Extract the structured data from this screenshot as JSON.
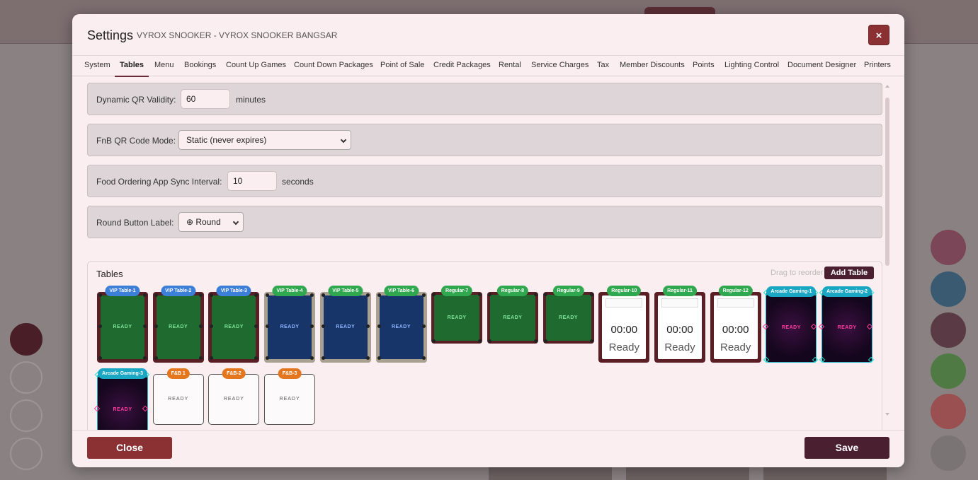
{
  "header": {
    "title": "Settings",
    "subtitle": "VYROX SNOOKER - VYROX SNOOKER BANGSAR",
    "close_icon": "×"
  },
  "tabs": [
    {
      "label": "System"
    },
    {
      "label": "Tables"
    },
    {
      "label": "Menu"
    },
    {
      "label": "Bookings"
    },
    {
      "label": "Count Up Games"
    },
    {
      "label": "Count Down Packages"
    },
    {
      "label": "Point of Sale"
    },
    {
      "label": "Credit Packages"
    },
    {
      "label": "Rental"
    },
    {
      "label": "Service Charges"
    },
    {
      "label": "Tax"
    },
    {
      "label": "Member Discounts"
    },
    {
      "label": "Points"
    },
    {
      "label": "Lighting Control"
    },
    {
      "label": "Document Designer"
    },
    {
      "label": "Printers"
    }
  ],
  "active_tab": "Tables",
  "settings": {
    "qr_validity": {
      "label": "Dynamic QR Validity:",
      "value": "60",
      "unit": "minutes"
    },
    "fnb_qr_mode": {
      "label": "FnB QR Code Mode:",
      "value": "Static (never expires)"
    },
    "sync_interval": {
      "label": "Food Ordering App Sync Interval:",
      "value": "10",
      "unit": "seconds"
    },
    "round_label": {
      "label": "Round Button Label:",
      "value": "⊕ Round"
    }
  },
  "tables_section": {
    "title": "Tables",
    "drag_hint": "Drag to reorder",
    "add_button": "Add Table",
    "tables": [
      {
        "name": "VIP Table-1",
        "type": "pool-green",
        "status": "READY"
      },
      {
        "name": "VIP Table-2",
        "type": "pool-green",
        "status": "READY"
      },
      {
        "name": "VIP Table-3",
        "type": "pool-green",
        "status": "READY"
      },
      {
        "name": "VIP Table-4",
        "type": "pool-blue",
        "status": "READY"
      },
      {
        "name": "VIP Table-5",
        "type": "pool-blue",
        "status": "READY"
      },
      {
        "name": "VIP Table-6",
        "type": "pool-blue",
        "status": "READY"
      },
      {
        "name": "Regular-7",
        "type": "regular-green",
        "status": "READY"
      },
      {
        "name": "Regular-8",
        "type": "regular-green",
        "status": "READY"
      },
      {
        "name": "Regular-9",
        "type": "regular-green",
        "status": "READY"
      },
      {
        "name": "Regular-10",
        "type": "timer",
        "timer": "00:00",
        "status": "Ready"
      },
      {
        "name": "Regular-11",
        "type": "timer",
        "timer": "00:00",
        "status": "Ready"
      },
      {
        "name": "Regular-12",
        "type": "timer",
        "timer": "00:00",
        "status": "Ready"
      },
      {
        "name": "Arcade Gaming-1",
        "type": "arcade",
        "status": "READY"
      },
      {
        "name": "Arcade Gaming-2",
        "type": "arcade",
        "status": "READY"
      },
      {
        "name": "Arcade Gaming-3",
        "type": "arcade",
        "status": "READY"
      },
      {
        "name": "F&B 1",
        "type": "fnb",
        "status": "READY"
      },
      {
        "name": "F&B-2",
        "type": "fnb",
        "status": "READY"
      },
      {
        "name": "F&B-3",
        "type": "fnb",
        "status": "READY"
      }
    ]
  },
  "footer": {
    "close_label": "Close",
    "save_label": "Save"
  },
  "colors": {
    "primary": "#4a2030",
    "danger": "#8b3134",
    "label_blue": "#3b7fd9",
    "label_green": "#2fa84f",
    "label_cyan": "#1aa7c4",
    "label_orange": "#e4761e"
  }
}
